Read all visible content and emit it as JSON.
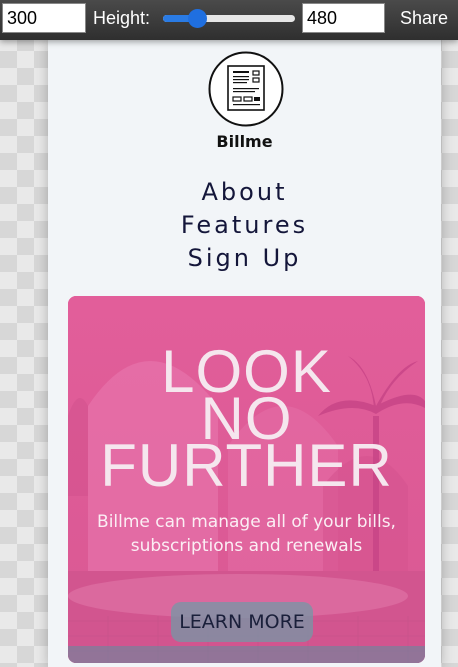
{
  "toolbar": {
    "width_value": "300",
    "height_label": "Height:",
    "height_value": "480",
    "slider_fraction": 0.22,
    "share_label": "Share"
  },
  "site": {
    "brand_name": "Billme",
    "logo_icon": "bill-document-icon",
    "nav": [
      "About",
      "Features",
      "Sign Up"
    ],
    "hero": {
      "title_lines": [
        "LOOK",
        "NO",
        "FURTHER"
      ],
      "subtitle": "Billme can manage all of your bills, subscriptions and renewals",
      "cta_label": "LEARN MORE"
    }
  },
  "colors": {
    "toolbar_bg": "#3a3a3a",
    "page_bg": "#f2f5f8",
    "nav_text": "#14163a",
    "hero_pink": "#de5c98",
    "slider_accent": "#1f6fe0"
  }
}
